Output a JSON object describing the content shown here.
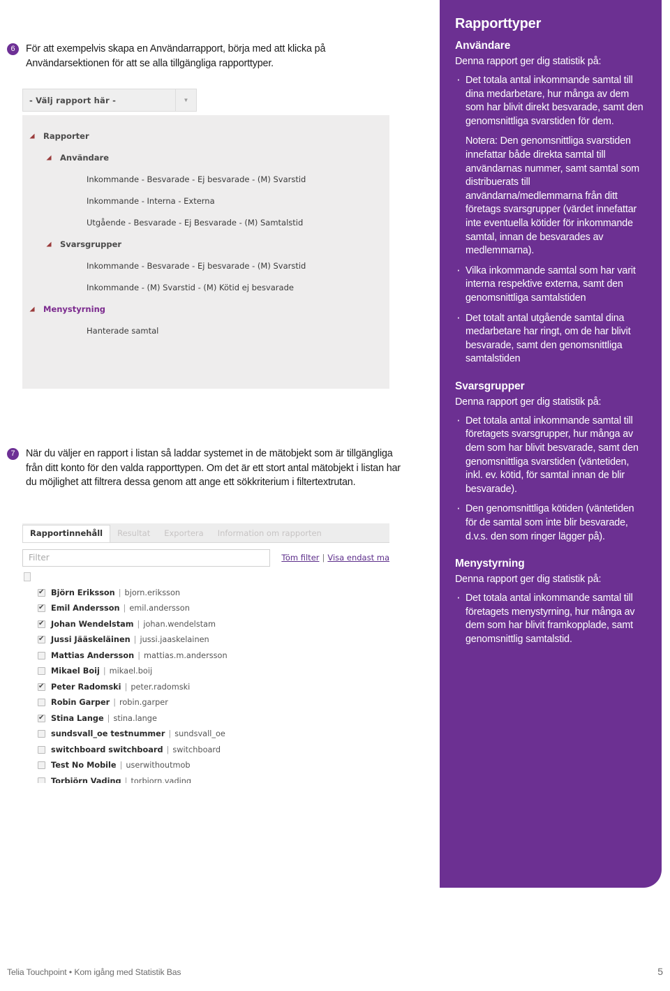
{
  "steps": [
    {
      "number": "6",
      "text": "För att exempelvis skapa en Användarrapport, börja med att klicka på Användarsektionen för att se alla tillgängliga rapporttyper."
    },
    {
      "number": "7",
      "text": "När du väljer en rapport i listan så laddar systemet in de mätobjekt som är tillgängliga från ditt konto för den valda rapporttypen. Om det är ett stort antal mätobjekt i listan har du möjlighet att filtrera dessa genom att ange ett sökkriterium i filtertextrutan."
    }
  ],
  "report_picker": {
    "select_label": "- Välj rapport här -",
    "tree": [
      {
        "label": "Rapporter",
        "level": 0,
        "arrow": true,
        "accent": false
      },
      {
        "label": "Användare",
        "level": 1,
        "arrow": true,
        "accent": false
      },
      {
        "label": "Inkommande - Besvarade - Ej besvarade - (M) Svarstid",
        "level": 2,
        "arrow": false,
        "accent": false
      },
      {
        "label": "Inkommande - Interna - Externa",
        "level": 2,
        "arrow": false,
        "accent": false
      },
      {
        "label": "Utgående - Besvarade - Ej Besvarade - (M) Samtalstid",
        "level": 2,
        "arrow": false,
        "accent": false
      },
      {
        "label": "Svarsgrupper",
        "level": 1,
        "arrow": true,
        "accent": false
      },
      {
        "label": "Inkommande - Besvarade - Ej besvarade - (M) Svarstid",
        "level": 2,
        "arrow": false,
        "accent": false
      },
      {
        "label": "Inkommande - (M) Svarstid - (M) Kötid ej besvarade",
        "level": 2,
        "arrow": false,
        "accent": false
      },
      {
        "label": "Menystyrning",
        "level": 0,
        "arrow": true,
        "accent": true
      },
      {
        "label": "Hanterade samtal",
        "level": 2,
        "arrow": false,
        "accent": false
      }
    ]
  },
  "report_content": {
    "tabs": [
      {
        "label": "Rapportinnehåll",
        "active": true
      },
      {
        "label": "Resultat",
        "active": false
      },
      {
        "label": "Exportera",
        "active": false
      },
      {
        "label": "Information om rapporten",
        "active": false
      }
    ],
    "filter_placeholder": "Filter",
    "filter_value": "",
    "clear_filter_link": "Töm filter",
    "separator": "|",
    "show_only_link": "Visa endast ma",
    "users": [
      {
        "name": "Björn Eriksson",
        "login": "bjorn.eriksson",
        "checked": true
      },
      {
        "name": "Emil Andersson",
        "login": "emil.andersson",
        "checked": true
      },
      {
        "name": "Johan Wendelstam",
        "login": "johan.wendelstam",
        "checked": true
      },
      {
        "name": "Jussi Jääskeläinen",
        "login": "jussi.jaaskelainen",
        "checked": true
      },
      {
        "name": "Mattias Andersson",
        "login": "mattias.m.andersson",
        "checked": false
      },
      {
        "name": "Mikael Boij",
        "login": "mikael.boij",
        "checked": false
      },
      {
        "name": "Peter Radomski",
        "login": "peter.radomski",
        "checked": true
      },
      {
        "name": "Robin Garper",
        "login": "robin.garper",
        "checked": false
      },
      {
        "name": "Stina Lange",
        "login": "stina.lange",
        "checked": true
      },
      {
        "name": "sundsvall_oe testnummer",
        "login": "sundsvall_oe",
        "checked": false
      },
      {
        "name": "switchboard switchboard",
        "login": "switchboard",
        "checked": false
      },
      {
        "name": "Test No Mobile",
        "login": "userwithoutmob",
        "checked": false
      },
      {
        "name": "Torbjörn Vading",
        "login": "torbjorn.vading",
        "checked": false
      }
    ]
  },
  "sidebar": {
    "title": "Rapporttyper",
    "accent_color": "#6c3092",
    "sections": [
      {
        "heading": "Användare",
        "subheading": "Denna rapport ger dig statistik på:",
        "bullets": [
          {
            "text": "Det totala antal inkommande samtal till dina medarbetare, hur många av dem som har blivit direkt besvarade, samt den genomsnittliga svarstiden för dem.",
            "bullet": true
          },
          {
            "text": "Notera: Den genomsnittliga svarstiden innefattar både direkta samtal till användarnas nummer, samt samtal som distribuerats till användarna/medlemmarna från ditt företags svarsgrupper (värdet innefattar inte eventuella kötider för inkommande samtal, innan de besvarades av medlemmarna).",
            "bullet": false
          },
          {
            "text": "Vilka inkommande samtal som har varit interna respektive externa, samt den genomsnittliga samtalstiden",
            "bullet": true
          },
          {
            "text": "Det totalt antal utgående samtal dina medarbetare har ringt, om de har blivit besvarade, samt den genomsnittliga samtalstiden",
            "bullet": true
          }
        ]
      },
      {
        "heading": "Svarsgrupper",
        "subheading": "Denna rapport ger dig statistik på:",
        "bullets": [
          {
            "text": "Det totala antal inkommande samtal till företagets svarsgrupper, hur många av dem som har blivit besvarade, samt den genomsnittliga svarstiden (väntetiden, inkl. ev. kötid, för samtal innan de blir besvarade).",
            "bullet": true
          },
          {
            "text": "Den genomsnittliga kötiden (väntetiden för de samtal som inte blir besvarade, d.v.s. den som ringer lägger på).",
            "bullet": true
          }
        ]
      },
      {
        "heading": "Menystyrning",
        "subheading": "Denna rapport ger dig statistik på:",
        "bullets": [
          {
            "text": "Det totala antal inkommande samtal till företagets menystyrning, hur många av dem som har blivit framkopplade, samt genomsnittlig samtalstid.",
            "bullet": true
          }
        ]
      }
    ]
  },
  "footer": {
    "text": "Telia Touchpoint • Kom igång med Statistik Bas",
    "page_number": "5"
  }
}
